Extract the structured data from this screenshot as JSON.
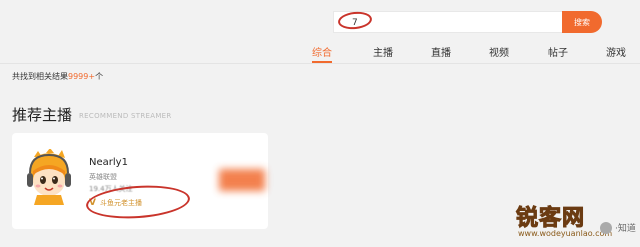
{
  "search": {
    "query": "7",
    "button_label": "搜索"
  },
  "tabs": [
    {
      "label": "综合",
      "active": true
    },
    {
      "label": "主播",
      "active": false
    },
    {
      "label": "直播",
      "active": false
    },
    {
      "label": "视频",
      "active": false
    },
    {
      "label": "帖子",
      "active": false
    },
    {
      "label": "游戏",
      "active": false
    }
  ],
  "results": {
    "prefix": "共找到相关结果",
    "count": "9999+",
    "suffix": "个"
  },
  "section": {
    "title": "推荐主播",
    "subtitle": "RECOMMEND STREAMER"
  },
  "streamer": {
    "name": "Nearly1",
    "category": "英雄联盟",
    "followers": "19.4万人关注",
    "badge_icon": "V",
    "badge_label": "斗鱼元老主播"
  },
  "watermark": {
    "brand": "锐客网",
    "site": "www.wodeyuanlao.com",
    "sub": "·知道"
  },
  "colors": {
    "accent": "#f16a2e",
    "annotation": "#c9342b",
    "badge": "#d2932f",
    "background": "#f2f2f2"
  },
  "icons": {
    "avatar": "cartoon-avatar-with-headphones",
    "badge": "v-badge-icon"
  }
}
